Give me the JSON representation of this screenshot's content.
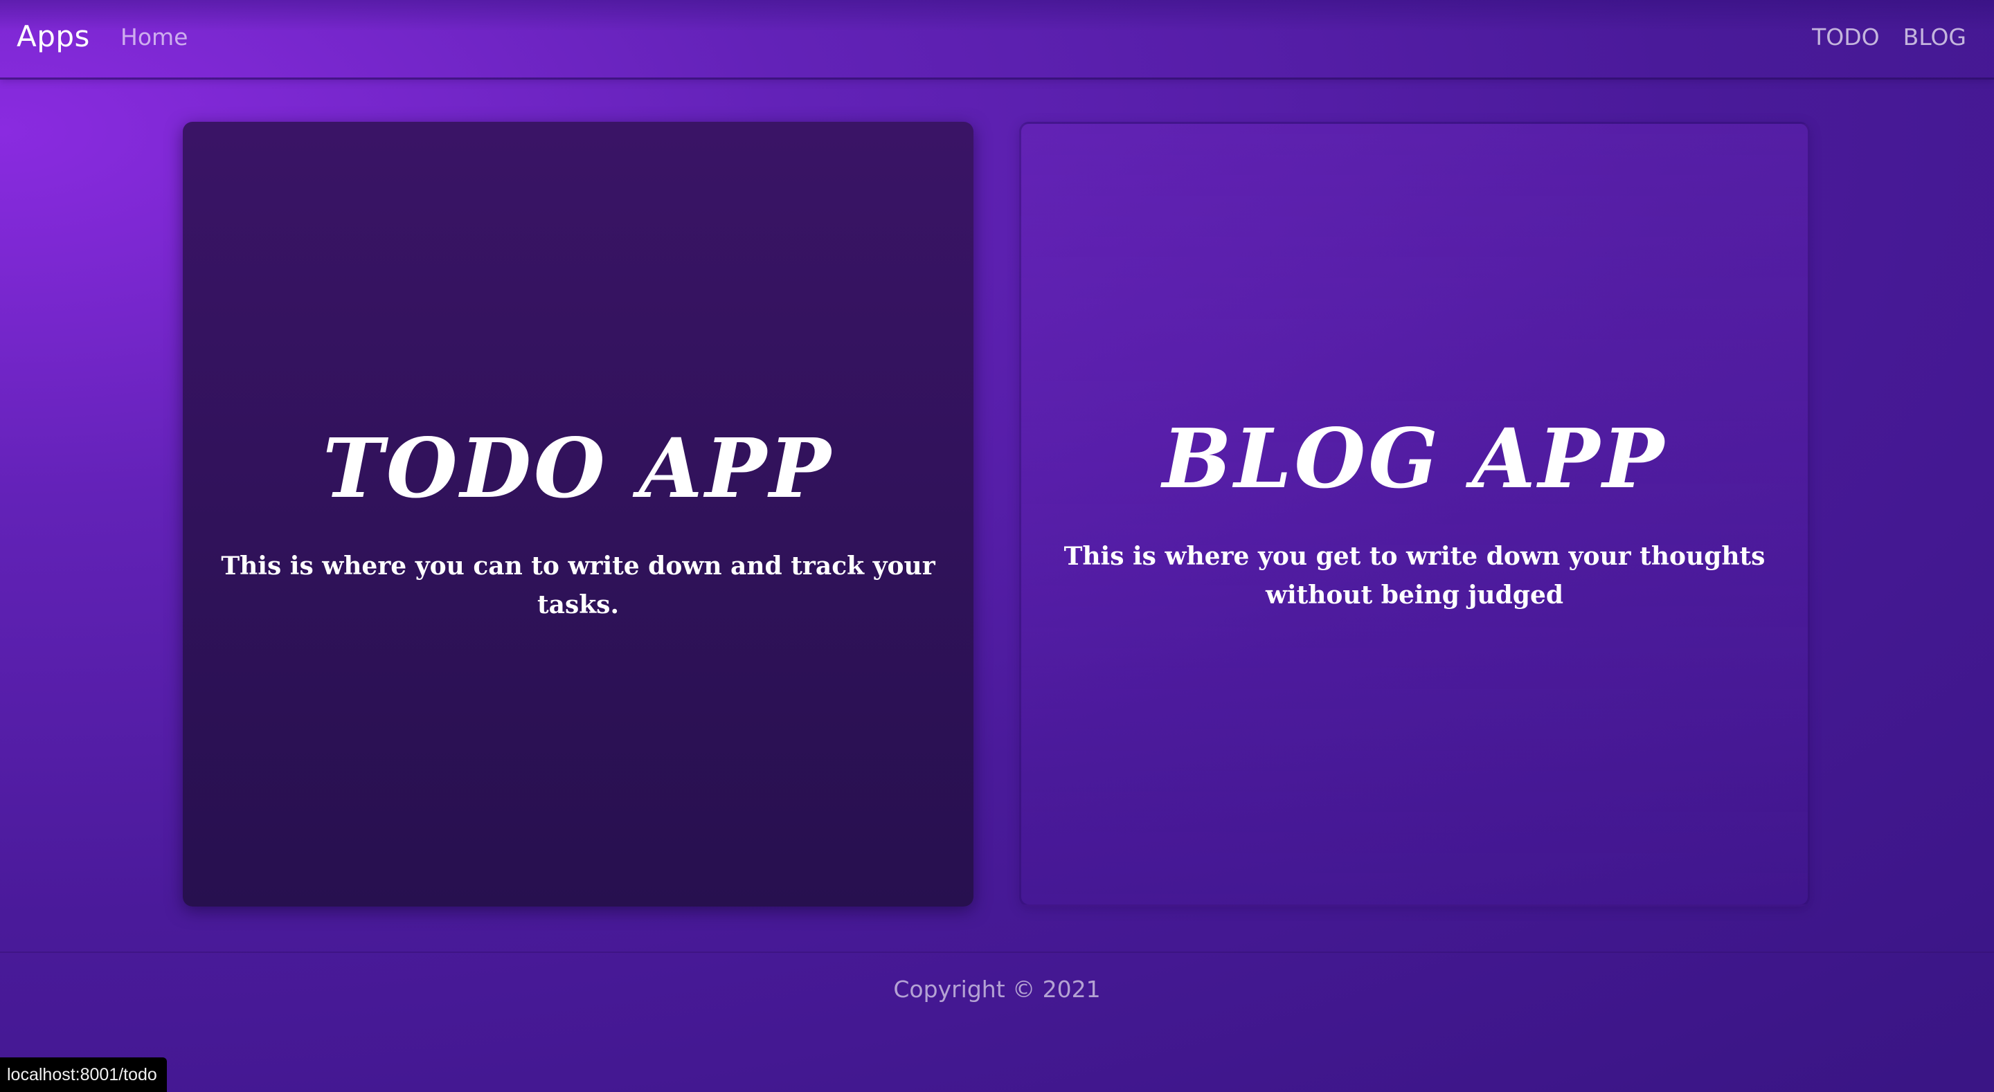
{
  "navbar": {
    "brand": "Apps",
    "home_label": "Home",
    "right_links": [
      "TODO",
      "BLOG"
    ]
  },
  "cards": [
    {
      "title": "TODO APP",
      "description": "This is where you can to write down and track your tasks."
    },
    {
      "title": "BLOG APP",
      "description": "This is where you get to write down your thoughts without being judged"
    }
  ],
  "footer": {
    "text": "Copyright © 2021"
  },
  "status_bar": {
    "url": "localhost:8001/todo"
  }
}
